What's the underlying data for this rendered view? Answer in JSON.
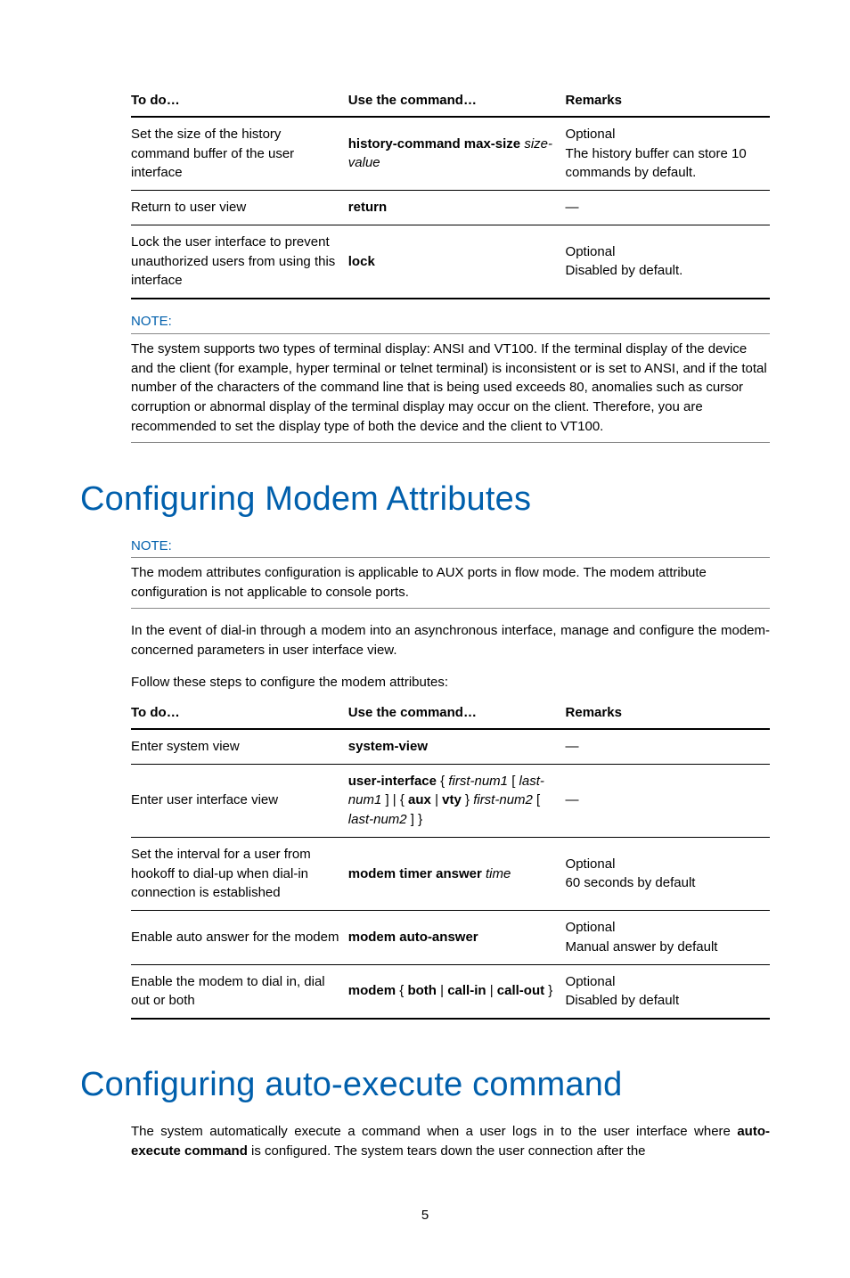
{
  "table1": {
    "headers": [
      "To do…",
      "Use the command…",
      "Remarks"
    ],
    "rows": [
      {
        "c1": "Set the size of the history command buffer of the user interface",
        "c2a": "history-command max-size",
        "c2b": "size-value",
        "c3a": "Optional",
        "c3b": "The history buffer can store 10 commands by default."
      },
      {
        "c1": "Return to user view",
        "c2a": "return",
        "c3a": "—"
      },
      {
        "c1": "Lock the user interface to prevent unauthorized users from using this interface",
        "c2a": "lock",
        "c3a": "Optional",
        "c3b": "Disabled by default."
      }
    ]
  },
  "note1": {
    "label": "NOTE:",
    "text": "The system supports two types of terminal display: ANSI and VT100. If the terminal display of the device and the client (for example, hyper terminal or telnet terminal) is inconsistent or is set to ANSI, and if the total number of the characters of the command line that is being used exceeds 80, anomalies such as cursor corruption or abnormal display of the terminal display may occur on the client. Therefore, you are recommended to set the display type of both the device and the client to VT100."
  },
  "h1a": "Configuring Modem Attributes",
  "note2": {
    "label": "NOTE:",
    "text": "The modem attributes configuration is applicable to AUX ports in flow mode. The modem attribute configuration is not applicable to console ports."
  },
  "para1": "In the event of dial-in through a modem into an asynchronous interface, manage and configure the modem-concerned parameters in user interface view.",
  "para2": "Follow these steps to configure the modem attributes:",
  "table2": {
    "headers": [
      "To do…",
      "Use the command…",
      "Remarks"
    ],
    "rows": [
      {
        "c1": "Enter system view",
        "c2_bold": "system-view",
        "c3": "—"
      },
      {
        "c1": "Enter user interface view",
        "cmd_bold1": "user-interface",
        "cmd_it1": "first-num1",
        "cmd_it2": "last-num1",
        "cmd_bold2": "aux",
        "cmd_bold3": "vty",
        "cmd_it3": "first-num2",
        "cmd_it4": "last-num2",
        "c3": "—"
      },
      {
        "c1": "Set the interval for a user from hookoff to dial-up when dial-in connection is established",
        "cmd_bold1": "modem timer answer",
        "cmd_it1": "time",
        "c3a": "Optional",
        "c3b": "60 seconds by default"
      },
      {
        "c1": "Enable auto answer for the modem",
        "cmd_bold1": "modem auto-answer",
        "c3a": "Optional",
        "c3b": "Manual answer by default"
      },
      {
        "c1": "Enable the modem to dial in, dial out or both",
        "cmd_bold1": "modem",
        "cmd_bold2": "both",
        "cmd_bold3": "call-in",
        "cmd_bold4": "call-out",
        "c3a": "Optional",
        "c3b": "Disabled by default"
      }
    ]
  },
  "h1b": "Configuring auto-execute command",
  "para3a": "The system automatically execute a command when a user logs in to the user interface where ",
  "para3bold": "auto-execute command",
  "para3b": " is configured. The system tears down the user connection after the",
  "pagenum": "5"
}
